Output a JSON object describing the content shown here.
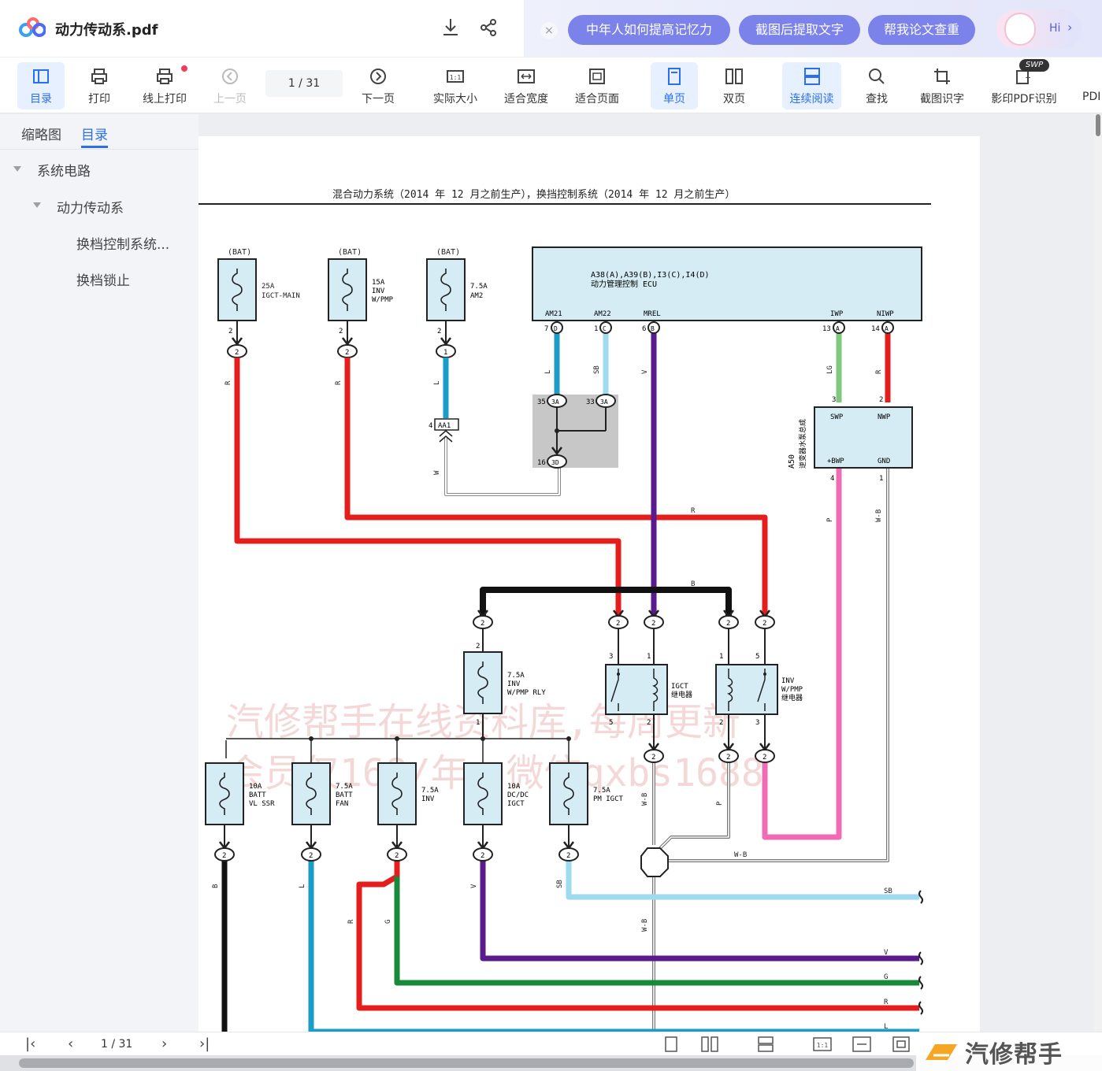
{
  "titlebar": {
    "filename": "动力传动系.pdf",
    "close": "×",
    "pills": [
      "中年人如何提高记忆力",
      "截图后提取文字",
      "帮我论文查重"
    ],
    "hi": "Hi"
  },
  "toolbar": {
    "items": [
      "目录",
      "打印",
      "线上打印",
      "上一页",
      "下一页",
      "实际大小",
      "适合宽度",
      "适合页面",
      "单页",
      "双页",
      "连续阅读",
      "查找",
      "截图识字",
      "影印PDF识别",
      "PDI"
    ],
    "page": "1  / 31",
    "badge": "SWP"
  },
  "sidebar": {
    "tabs": [
      "缩略图",
      "目录"
    ],
    "tree": [
      "系统电路",
      "动力传动系",
      "换档控制系统...",
      "换档锁止"
    ]
  },
  "bottombar": {
    "page": "1  / 31"
  },
  "brand": {
    "text": "汽修帮手"
  },
  "diagram": {
    "title": "混合动力系统（2014 年 12 月之前生产），换挡控制系统（2014 年 12 月之前生产）",
    "watermark1": "汽修帮手在线资料库,每周更新",
    "watermark2": "会员仅168/年，微信qxbs1688",
    "bat": "(BAT)",
    "ecu_line1": "A38(A),A39(B),I3(C),I4(D)",
    "ecu_line2": "动力管理控制 ECU",
    "ecu_pins": [
      "AM21",
      "AM22",
      "MREL",
      "IWP",
      "NIWP"
    ],
    "fuse1": "25A\nIGCT-MAIN",
    "fuse2": "15A\nINV\nW/PMP",
    "fuse3": "7.5A\nAM2",
    "fuse_rly": "7.5A\nINV\nW/PMP RLY",
    "relay1": "IGCT\n继电器",
    "relay2": "INV\nW/PMP\n继电器",
    "pump_id": "A50\n逆变器水泵总成",
    "pump_pins": [
      "SWP",
      "NWP",
      "+BWP",
      "GND"
    ],
    "fb1": "10A\nBATT\nVL SSR",
    "fb2": "7.5A\nBATT\nFAN",
    "fb3": "7.5A\nINV",
    "fb4": "10A\nDC/DC\nIGCT",
    "fb5": "7.5A\nPM IGCT",
    "connector_aa1": "AA1",
    "wire_labels": [
      "R",
      "R",
      "L",
      "L",
      "SB",
      "V",
      "LG",
      "R",
      "W",
      "R",
      "B",
      "P",
      "W-B",
      "W-B",
      "W-B",
      "P",
      "W-B",
      "W-B",
      "SB",
      "V",
      "G",
      "R",
      "L",
      "B",
      "L",
      "R",
      "G",
      "V",
      "SB"
    ]
  }
}
